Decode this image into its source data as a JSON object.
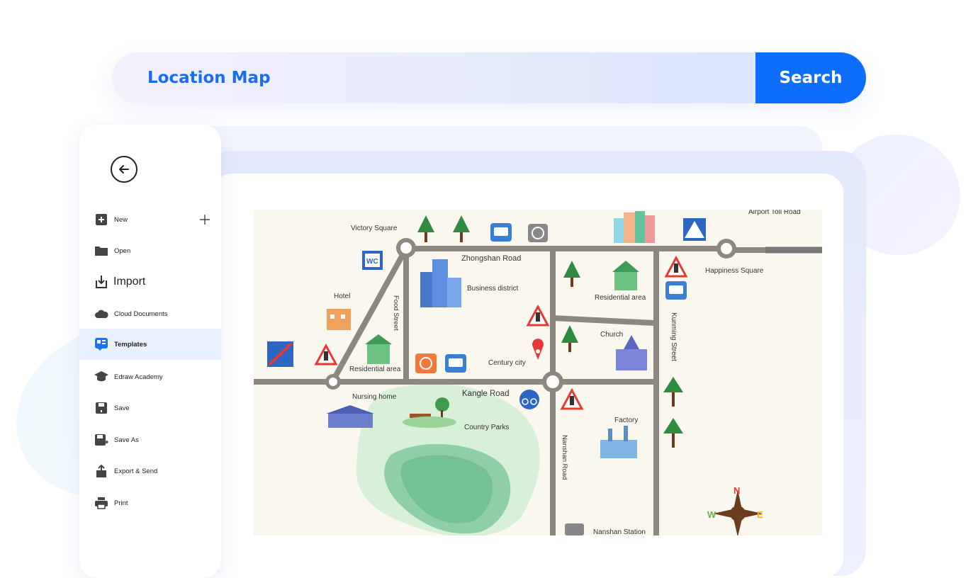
{
  "search": {
    "placeholder": "Location Map",
    "button_label": "Search"
  },
  "sidebar": {
    "items": [
      {
        "label": "New",
        "icon": "new-file-icon"
      },
      {
        "label": "Open",
        "icon": "folder-icon"
      },
      {
        "label": "Import",
        "icon": "import-icon"
      },
      {
        "label": "Cloud Documents",
        "icon": "cloud-icon"
      },
      {
        "label": "Templates",
        "icon": "templates-icon"
      },
      {
        "label": "Edraw Academy",
        "icon": "academy-cap-icon"
      },
      {
        "label": "Save",
        "icon": "save-icon"
      },
      {
        "label": "Save As",
        "icon": "save-as-icon"
      },
      {
        "label": "Export & Send",
        "icon": "export-icon"
      },
      {
        "label": "Print",
        "icon": "print-icon"
      }
    ],
    "active_item": "Templates"
  },
  "map": {
    "labels": {
      "victory_square": "Victory Square",
      "zhongshan_road": "Zhongshan Road",
      "airport_toll_road": "Airport Toll Road",
      "happiness_square": "Happiness Square",
      "hotel": "Hotel",
      "food_street": "Food Street",
      "business_district": "Business district",
      "residential_area_1": "Residential area",
      "residential_area_2": "Residential area",
      "kunming_street": "Kunming Street",
      "church": "Church",
      "century_city": "Century city",
      "kangle_road": "Kangle Road",
      "nursing_home": "Nursing home",
      "country_parks": "Country Parks",
      "factory": "Factory",
      "nanshan_road": "Nanshan Road",
      "nanshan_station": "Nanshan Station",
      "wc": "WC"
    },
    "compass": {
      "n": "N",
      "e": "E",
      "w": "W"
    }
  },
  "colors": {
    "accent": "#0d6efd",
    "road": "#8c887f",
    "map_bg": "#faf8ee",
    "active_bg": "#e8f1fd"
  }
}
